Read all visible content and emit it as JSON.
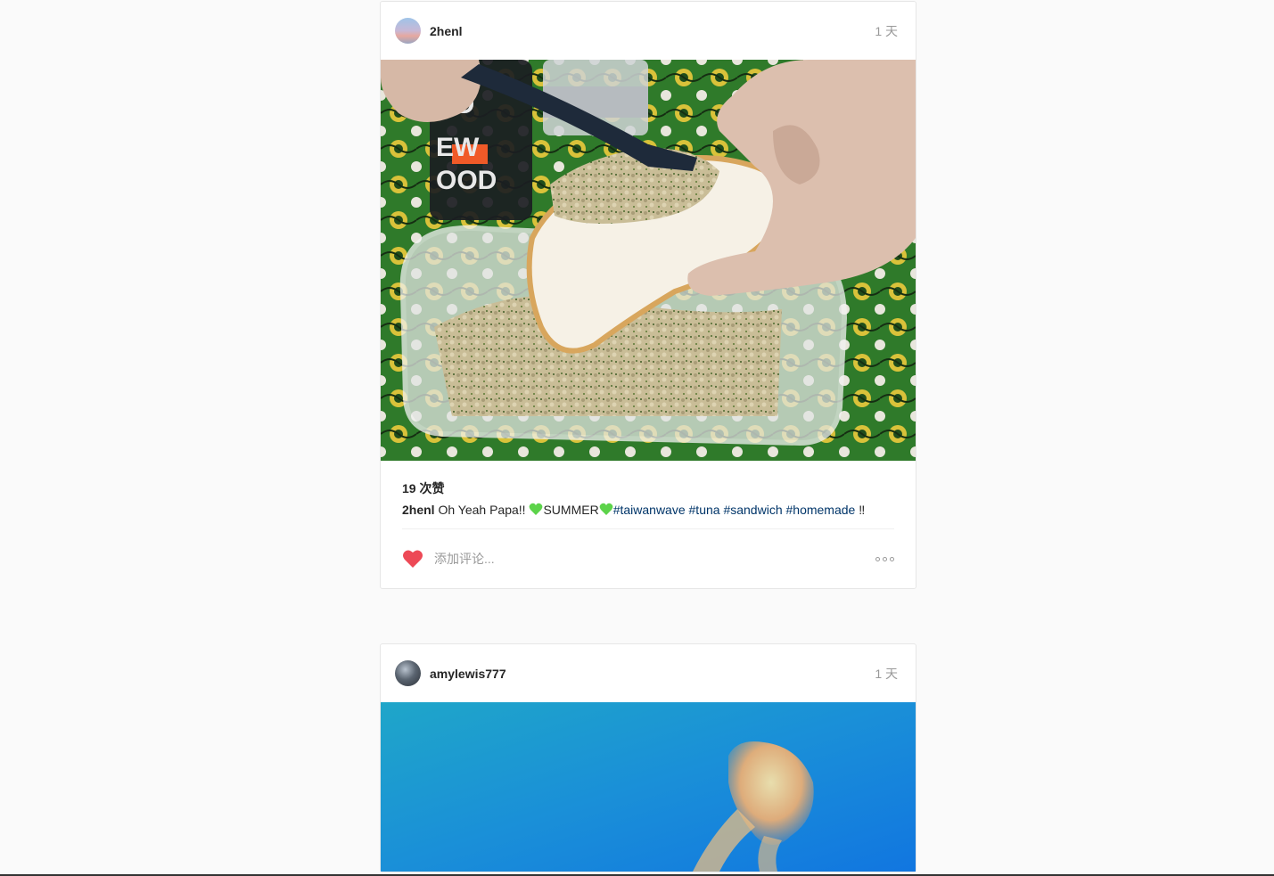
{
  "posts": [
    {
      "username": "2henl",
      "time": "1 天",
      "likes": "19 次赞",
      "caption": {
        "author": "2henl",
        "text_before": " Oh Yeah Papa!! ",
        "emoji_name": "green-heart-icon",
        "word": "SUMMER",
        "tags": [
          "#taiwanwave",
          "#tuna",
          "#sandwich",
          "#homemade"
        ],
        "suffix": "‼"
      },
      "comment_placeholder": "添加评论..."
    },
    {
      "username": "amylewis777",
      "time": "1 天"
    }
  ],
  "colors": {
    "like_heart": "#ed4956",
    "hashtag": "#003569",
    "green_heart": "#5cd34a"
  }
}
